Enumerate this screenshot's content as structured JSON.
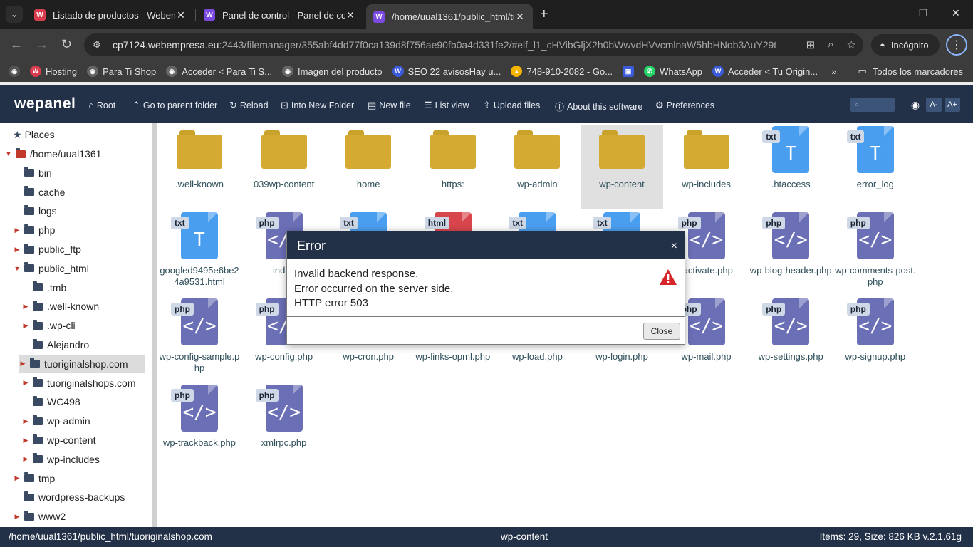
{
  "browser": {
    "tabs": [
      {
        "title": "Listado de productos - Webemp",
        "favicon": "W",
        "favicon_color": "#d93b4f"
      },
      {
        "title": "Panel de control - Panel de cont",
        "favicon": "W",
        "favicon_color": "#7b4ae0"
      },
      {
        "title": "/home/uual1361/public_html/tu",
        "favicon": "W",
        "favicon_color": "#7b4ae0"
      }
    ],
    "url_host": "cp7124.webempresa.eu",
    "url_path": ":2443/filemanager/355abf4dd77f0ca139d8f756ae90fb0a4d331fe2/#elf_l1_cHVibGljX2h0bWwvdHVvcmlnaW5hbHNob3AuY29t",
    "incognito_label": "Incógnito",
    "bookmarks": [
      {
        "label": "Hosting",
        "icon": "W",
        "color": "#d93b4f"
      },
      {
        "label": "Para Ti Shop",
        "icon": "◉",
        "color": "#555"
      },
      {
        "label": "Acceder < Para Ti S...",
        "icon": "◉",
        "color": "#555"
      },
      {
        "label": "Imagen del producto",
        "icon": "◉",
        "color": "#555"
      },
      {
        "label": "SEO 22 avisosHay u...",
        "icon": "W",
        "color": "#3b5bdb"
      },
      {
        "label": "748-910-2082 - Go...",
        "icon": "▲",
        "color": "#f4b400"
      },
      {
        "label": "",
        "icon": "▣",
        "color": "#3b5bdb"
      },
      {
        "label": "WhatsApp",
        "icon": "✆",
        "color": "#25d366"
      },
      {
        "label": "Acceder < Tu Origin...",
        "icon": "W",
        "color": "#3b5bdb"
      }
    ],
    "all_bookmarks_label": "Todos los marcadores"
  },
  "app": {
    "logo": "wepanel",
    "toolbar": [
      {
        "label": "Root",
        "icon": "home-icon",
        "glyph": "⌂"
      },
      {
        "label": "Go to parent folder",
        "icon": "up-icon",
        "glyph": "⌃"
      },
      {
        "label": "Reload",
        "icon": "reload-icon",
        "glyph": "↻"
      },
      {
        "label": "Into New Folder",
        "icon": "folder-in-icon",
        "glyph": "⊡"
      },
      {
        "label": "New file",
        "icon": "file-icon",
        "glyph": "▤"
      },
      {
        "label": "List view",
        "icon": "list-icon",
        "glyph": "☰"
      },
      {
        "label": "Upload files",
        "icon": "upload-icon",
        "glyph": "⇪"
      },
      {
        "label": "About this software",
        "icon": "info-icon",
        "glyph": "ⓘ"
      },
      {
        "label": "Preferences",
        "icon": "prefs-icon",
        "glyph": "⚙"
      }
    ],
    "font_small": "A-",
    "font_large": "A+",
    "sidebar": {
      "places": "Places",
      "items": [
        {
          "label": "/home/uual1361",
          "arrow": "▼"
        },
        {
          "label": "bin",
          "arrow": ""
        },
        {
          "label": "cache",
          "arrow": ""
        },
        {
          "label": "logs",
          "arrow": ""
        },
        {
          "label": "php",
          "arrow": "▶"
        },
        {
          "label": "public_ftp",
          "arrow": "▶"
        },
        {
          "label": "public_html",
          "arrow": "▼"
        },
        {
          "label": ".tmb",
          "arrow": ""
        },
        {
          "label": ".well-known",
          "arrow": "▶"
        },
        {
          "label": ".wp-cli",
          "arrow": "▶"
        },
        {
          "label": "Alejandro",
          "arrow": ""
        },
        {
          "label": "tuoriginalshop.com",
          "arrow": "▶"
        },
        {
          "label": "tuoriginalshops.com",
          "arrow": "▶"
        },
        {
          "label": "WC498",
          "arrow": ""
        },
        {
          "label": "wp-admin",
          "arrow": "▶"
        },
        {
          "label": "wp-content",
          "arrow": "▶"
        },
        {
          "label": "wp-includes",
          "arrow": "▶"
        },
        {
          "label": "tmp",
          "arrow": "▶"
        },
        {
          "label": "wordpress-backups",
          "arrow": ""
        },
        {
          "label": "www2",
          "arrow": "▶"
        }
      ]
    },
    "files": [
      {
        "label": ".well-known",
        "type": "folder"
      },
      {
        "label": "039wp-content",
        "type": "folder"
      },
      {
        "label": "home",
        "type": "folder"
      },
      {
        "label": "https:",
        "type": "folder"
      },
      {
        "label": "wp-admin",
        "type": "folder"
      },
      {
        "label": "wp-content",
        "type": "folder"
      },
      {
        "label": "wp-includes",
        "type": "folder"
      },
      {
        "label": ".htaccess",
        "type": "txt"
      },
      {
        "label": "error_log",
        "type": "txt"
      },
      {
        "label": "googled9495e6be24a9531.html",
        "type": "txt"
      },
      {
        "label": "index",
        "type": "php"
      },
      {
        "label": "",
        "type": "txt"
      },
      {
        "label": "",
        "type": "html"
      },
      {
        "label": "",
        "type": "txt"
      },
      {
        "label": "",
        "type": "txt"
      },
      {
        "label": "-activate.php",
        "type": "php"
      },
      {
        "label": "wp-blog-header.php",
        "type": "php"
      },
      {
        "label": "wp-comments-post.php",
        "type": "php"
      },
      {
        "label": "wp-config-sample.php",
        "type": "php"
      },
      {
        "label": "wp-config.php",
        "type": "php"
      },
      {
        "label": "wp-cron.php",
        "type": "none"
      },
      {
        "label": "wp-links-opml.php",
        "type": "none"
      },
      {
        "label": "wp-load.php",
        "type": "none"
      },
      {
        "label": "wp-login.php",
        "type": "none"
      },
      {
        "label": "wp-mail.php",
        "type": "php"
      },
      {
        "label": "wp-settings.php",
        "type": "php"
      },
      {
        "label": "wp-signup.php",
        "type": "php"
      },
      {
        "label": "wp-trackback.php",
        "type": "php"
      },
      {
        "label": "xmlrpc.php",
        "type": "php"
      }
    ],
    "status": {
      "path": "/home/uual1361/public_html/tuoriginalshop.com",
      "selected": "wp-content",
      "summary": "Items: 29, Size: 826 KB v.2.1.61g"
    }
  },
  "dialog": {
    "title": "Error",
    "close_x": "×",
    "lines": [
      "Invalid backend response.",
      "Error occurred on the server side.",
      "HTTP error 503"
    ],
    "button": "Close"
  }
}
